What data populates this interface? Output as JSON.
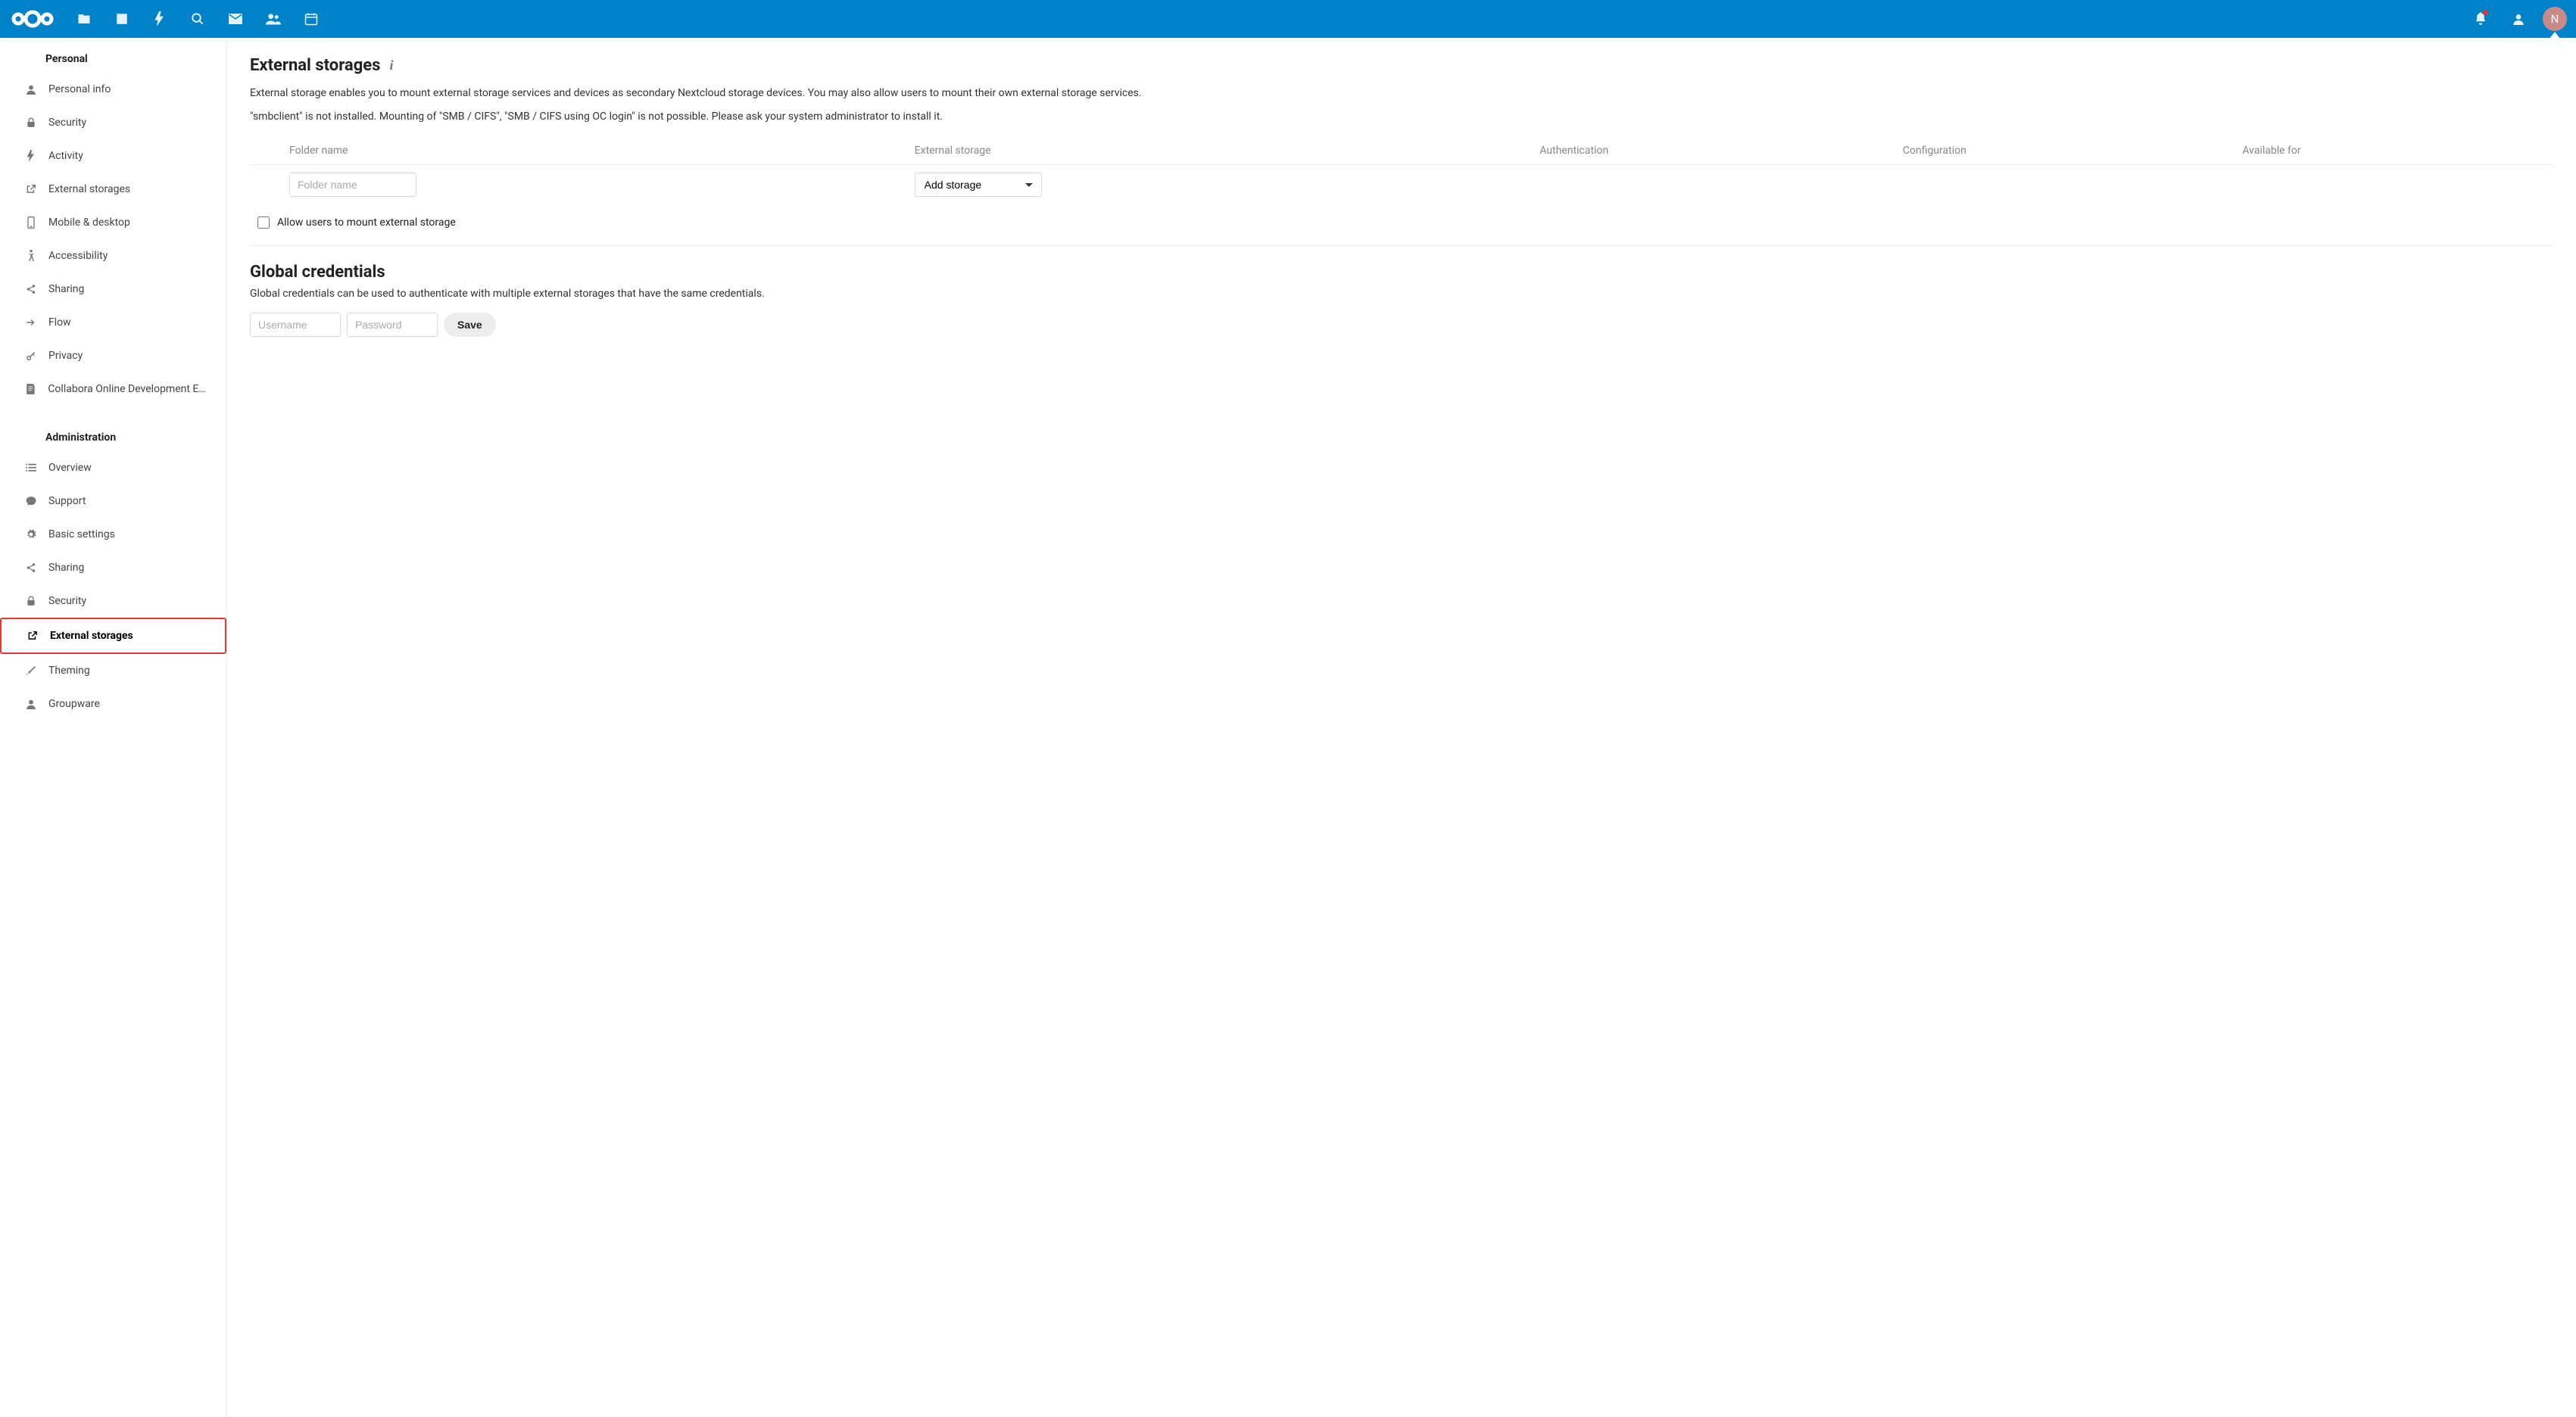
{
  "header": {
    "avatar_initial": "N"
  },
  "sidebar": {
    "personal": {
      "title": "Personal",
      "items": [
        {
          "label": "Personal info"
        },
        {
          "label": "Security"
        },
        {
          "label": "Activity"
        },
        {
          "label": "External storages"
        },
        {
          "label": "Mobile & desktop"
        },
        {
          "label": "Accessibility"
        },
        {
          "label": "Sharing"
        },
        {
          "label": "Flow"
        },
        {
          "label": "Privacy"
        },
        {
          "label": "Collabora Online Development Edit…"
        }
      ]
    },
    "admin": {
      "title": "Administration",
      "items": [
        {
          "label": "Overview"
        },
        {
          "label": "Support"
        },
        {
          "label": "Basic settings"
        },
        {
          "label": "Sharing"
        },
        {
          "label": "Security"
        },
        {
          "label": "External storages"
        },
        {
          "label": "Theming"
        },
        {
          "label": "Groupware"
        }
      ]
    }
  },
  "main": {
    "title": "External storages",
    "description": "External storage enables you to mount external storage services and devices as secondary Nextcloud storage devices. You may also allow users to mount their own external storage services.",
    "warning": "\"smbclient\" is not installed. Mounting of \"SMB / CIFS\", \"SMB / CIFS using OC login\" is not possible. Please ask your system administrator to install it.",
    "table": {
      "headers": {
        "folder": "Folder name",
        "external": "External storage",
        "auth": "Authentication",
        "config": "Configuration",
        "available": "Available for"
      },
      "folder_placeholder": "Folder name",
      "add_storage": "Add storage"
    },
    "allow_users_label": "Allow users to mount external storage",
    "global": {
      "title": "Global credentials",
      "description": "Global credentials can be used to authenticate with multiple external storages that have the same credentials.",
      "username_placeholder": "Username",
      "password_placeholder": "Password",
      "save": "Save"
    }
  }
}
